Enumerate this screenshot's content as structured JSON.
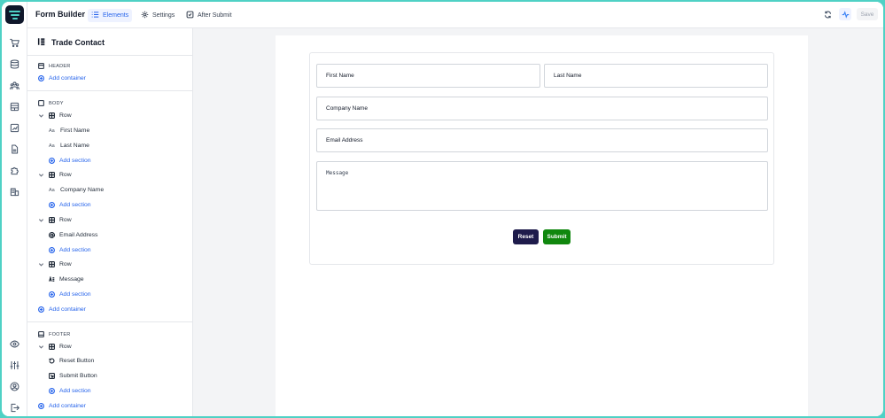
{
  "topbar": {
    "title": "Form Builder",
    "tabs": [
      {
        "label": "Elements",
        "icon": "list-icon",
        "active": true
      },
      {
        "label": "Settings",
        "icon": "gear-icon",
        "active": false
      },
      {
        "label": "After Submit",
        "icon": "check-square-icon",
        "active": false
      }
    ],
    "save_label": "Save"
  },
  "rail": {
    "top_icons": [
      "cart-icon",
      "database-icon",
      "users-icon",
      "table-icon",
      "chart-icon",
      "file-icon",
      "puzzle-icon",
      "building-icon"
    ],
    "bottom_icons": [
      "eye-icon",
      "sliders-icon",
      "user-circle-icon",
      "logout-icon"
    ]
  },
  "panel": {
    "title": "Trade Contact",
    "header_label": "HEADER",
    "body_label": "BODY",
    "footer_label": "FOOTER",
    "add_container": "Add container",
    "add_section": "Add section",
    "row_label": "Row",
    "fields": {
      "first_name": "First Name",
      "last_name": "Last Name",
      "company_name": "Company Name",
      "email_address": "Email Address",
      "message": "Message",
      "reset_button": "Reset Button",
      "submit_button": "Submit Button"
    }
  },
  "form": {
    "first_name": "First Name",
    "last_name": "Last Name",
    "company_name": "Company Name",
    "email_address": "Email Address",
    "message": "Message",
    "reset": "Reset",
    "submit": "Submit"
  },
  "colors": {
    "accent": "#2563eb",
    "frame": "#4fd1c5",
    "reset_button": "#1e1b4b",
    "submit_button": "#10870e"
  }
}
